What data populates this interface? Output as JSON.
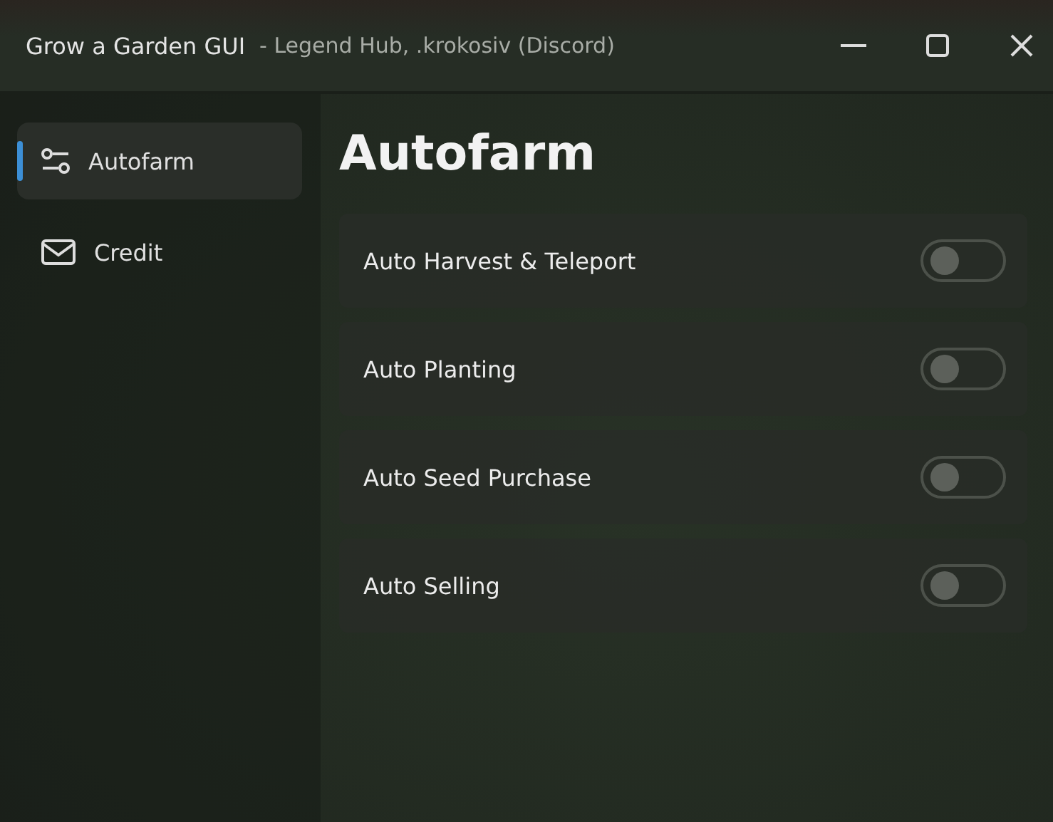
{
  "window": {
    "title": "Grow a Garden GUI",
    "subtitle": "- Legend Hub, .krokosiv (Discord)"
  },
  "sidebar": {
    "items": [
      {
        "label": "Autofarm",
        "selected": true
      },
      {
        "label": "Credit",
        "selected": false
      }
    ]
  },
  "page": {
    "heading": "Autofarm",
    "toggles": [
      {
        "label": "Auto Harvest & Teleport",
        "on": false
      },
      {
        "label": "Auto Planting",
        "on": false
      },
      {
        "label": "Auto Seed Purchase",
        "on": false
      },
      {
        "label": "Auto Selling",
        "on": false
      }
    ]
  }
}
